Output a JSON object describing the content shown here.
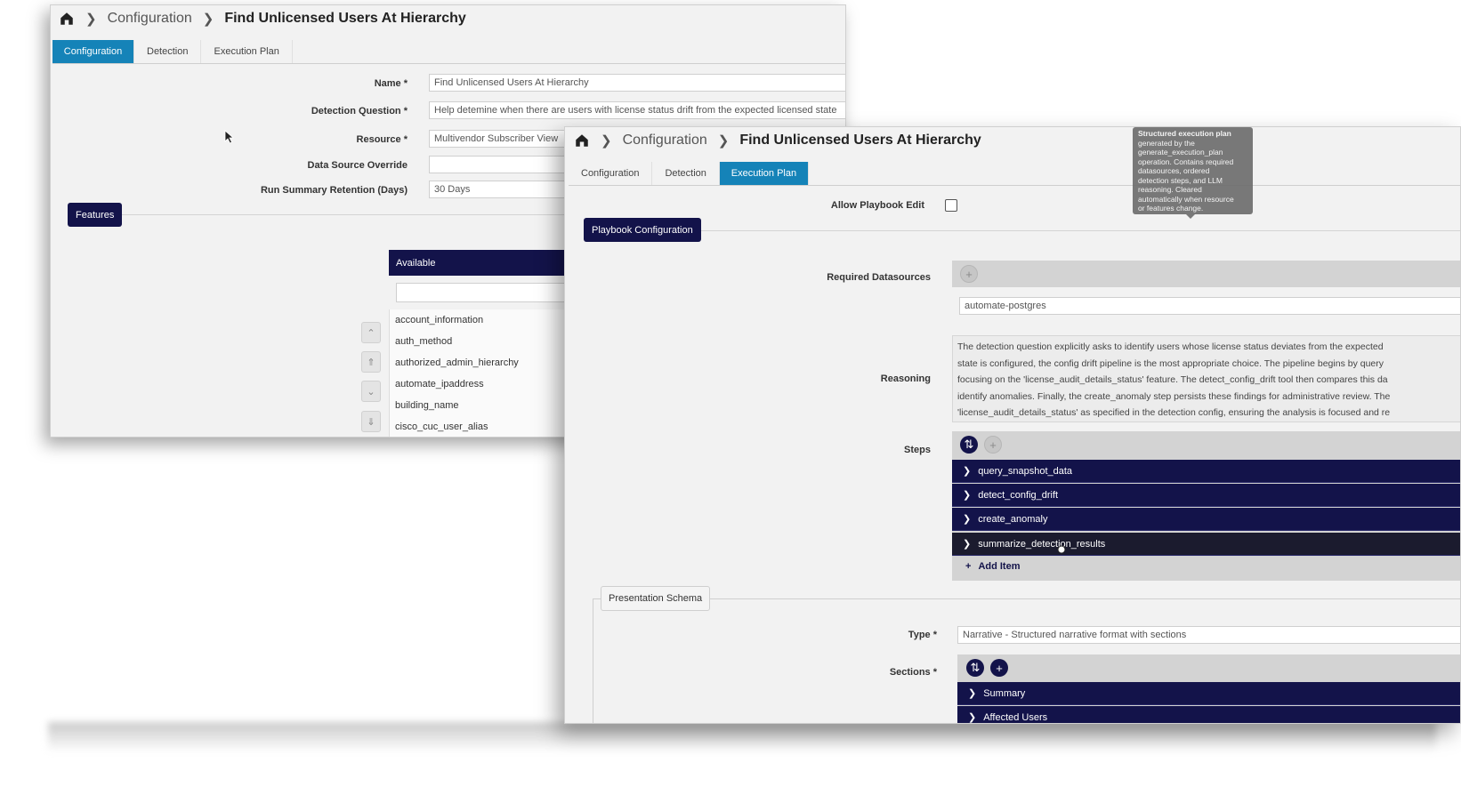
{
  "window_back": {
    "breadcrumb": {
      "level1": "Configuration",
      "current": "Find Unlicensed Users At Hierarchy"
    },
    "tabs": [
      {
        "label": "Configuration",
        "active": true
      },
      {
        "label": "Detection",
        "active": false
      },
      {
        "label": "Execution Plan",
        "active": false
      }
    ],
    "form": {
      "name_label": "Name *",
      "name_value": "Find Unlicensed Users At Hierarchy",
      "question_label": "Detection Question *",
      "question_value": "Help detemine when there are users with license status drift from the expected licensed state",
      "resource_label": "Resource *",
      "resource_value": "Multivendor Subscriber View",
      "override_label": "Data Source Override",
      "override_value": "",
      "retention_label": "Run Summary Retention (Days)",
      "retention_value": "30 Days"
    },
    "features_label": "Features",
    "available_label": "Available",
    "available_items": [
      "account_information",
      "auth_method",
      "authorized_admin_hierarchy",
      "automate_ipaddress",
      "building_name",
      "cisco_cuc_user_alias"
    ]
  },
  "window_front": {
    "breadcrumb": {
      "level1": "Configuration",
      "current": "Find Unlicensed Users At Hierarchy"
    },
    "tabs": [
      {
        "label": "Configuration",
        "active": false
      },
      {
        "label": "Detection",
        "active": false
      },
      {
        "label": "Execution Plan",
        "active": true
      }
    ],
    "allow_edit_label": "Allow Playbook Edit",
    "allow_edit_checked": false,
    "playbook_config_label": "Playbook Configuration",
    "tooltip": {
      "title": "Structured execution plan",
      "lines": [
        "generated by the",
        "generate_execution_plan",
        "operation. Contains required",
        "datasources, ordered",
        "detection steps, and LLM",
        "reasoning. Cleared",
        "automatically when resource",
        "or features change."
      ]
    },
    "required_ds_label": "Required Datasources",
    "required_ds_value": "automate-postgres",
    "reasoning_label": "Reasoning",
    "reasoning_lines": [
      "The detection question explicitly asks to identify users whose license status deviates from the expected",
      "state is configured, the config drift pipeline is the most appropriate choice. The pipeline begins by query",
      "focusing on the 'license_audit_details_status' feature. The detect_config_drift tool then compares this da",
      "identify anomalies. Finally, the create_anomaly step persists these findings for administrative review. The",
      "'license_audit_details_status' as specified in the detection config, ensuring the analysis is focused and re"
    ],
    "steps_label": "Steps",
    "steps": [
      "query_snapshot_data",
      "detect_config_drift",
      "create_anomaly",
      "summarize_detection_results"
    ],
    "add_item_label": "Add Item",
    "presentation_schema_label": "Presentation Schema",
    "type_label": "Type *",
    "type_value": "Narrative - Structured narrative format with sections",
    "sections_label": "Sections *",
    "sections": [
      "Summary",
      "Affected Users"
    ]
  },
  "colors": {
    "accent_blue": "#1583b8",
    "navy": "#13134a",
    "navy_hover": "#1b1b2e"
  }
}
